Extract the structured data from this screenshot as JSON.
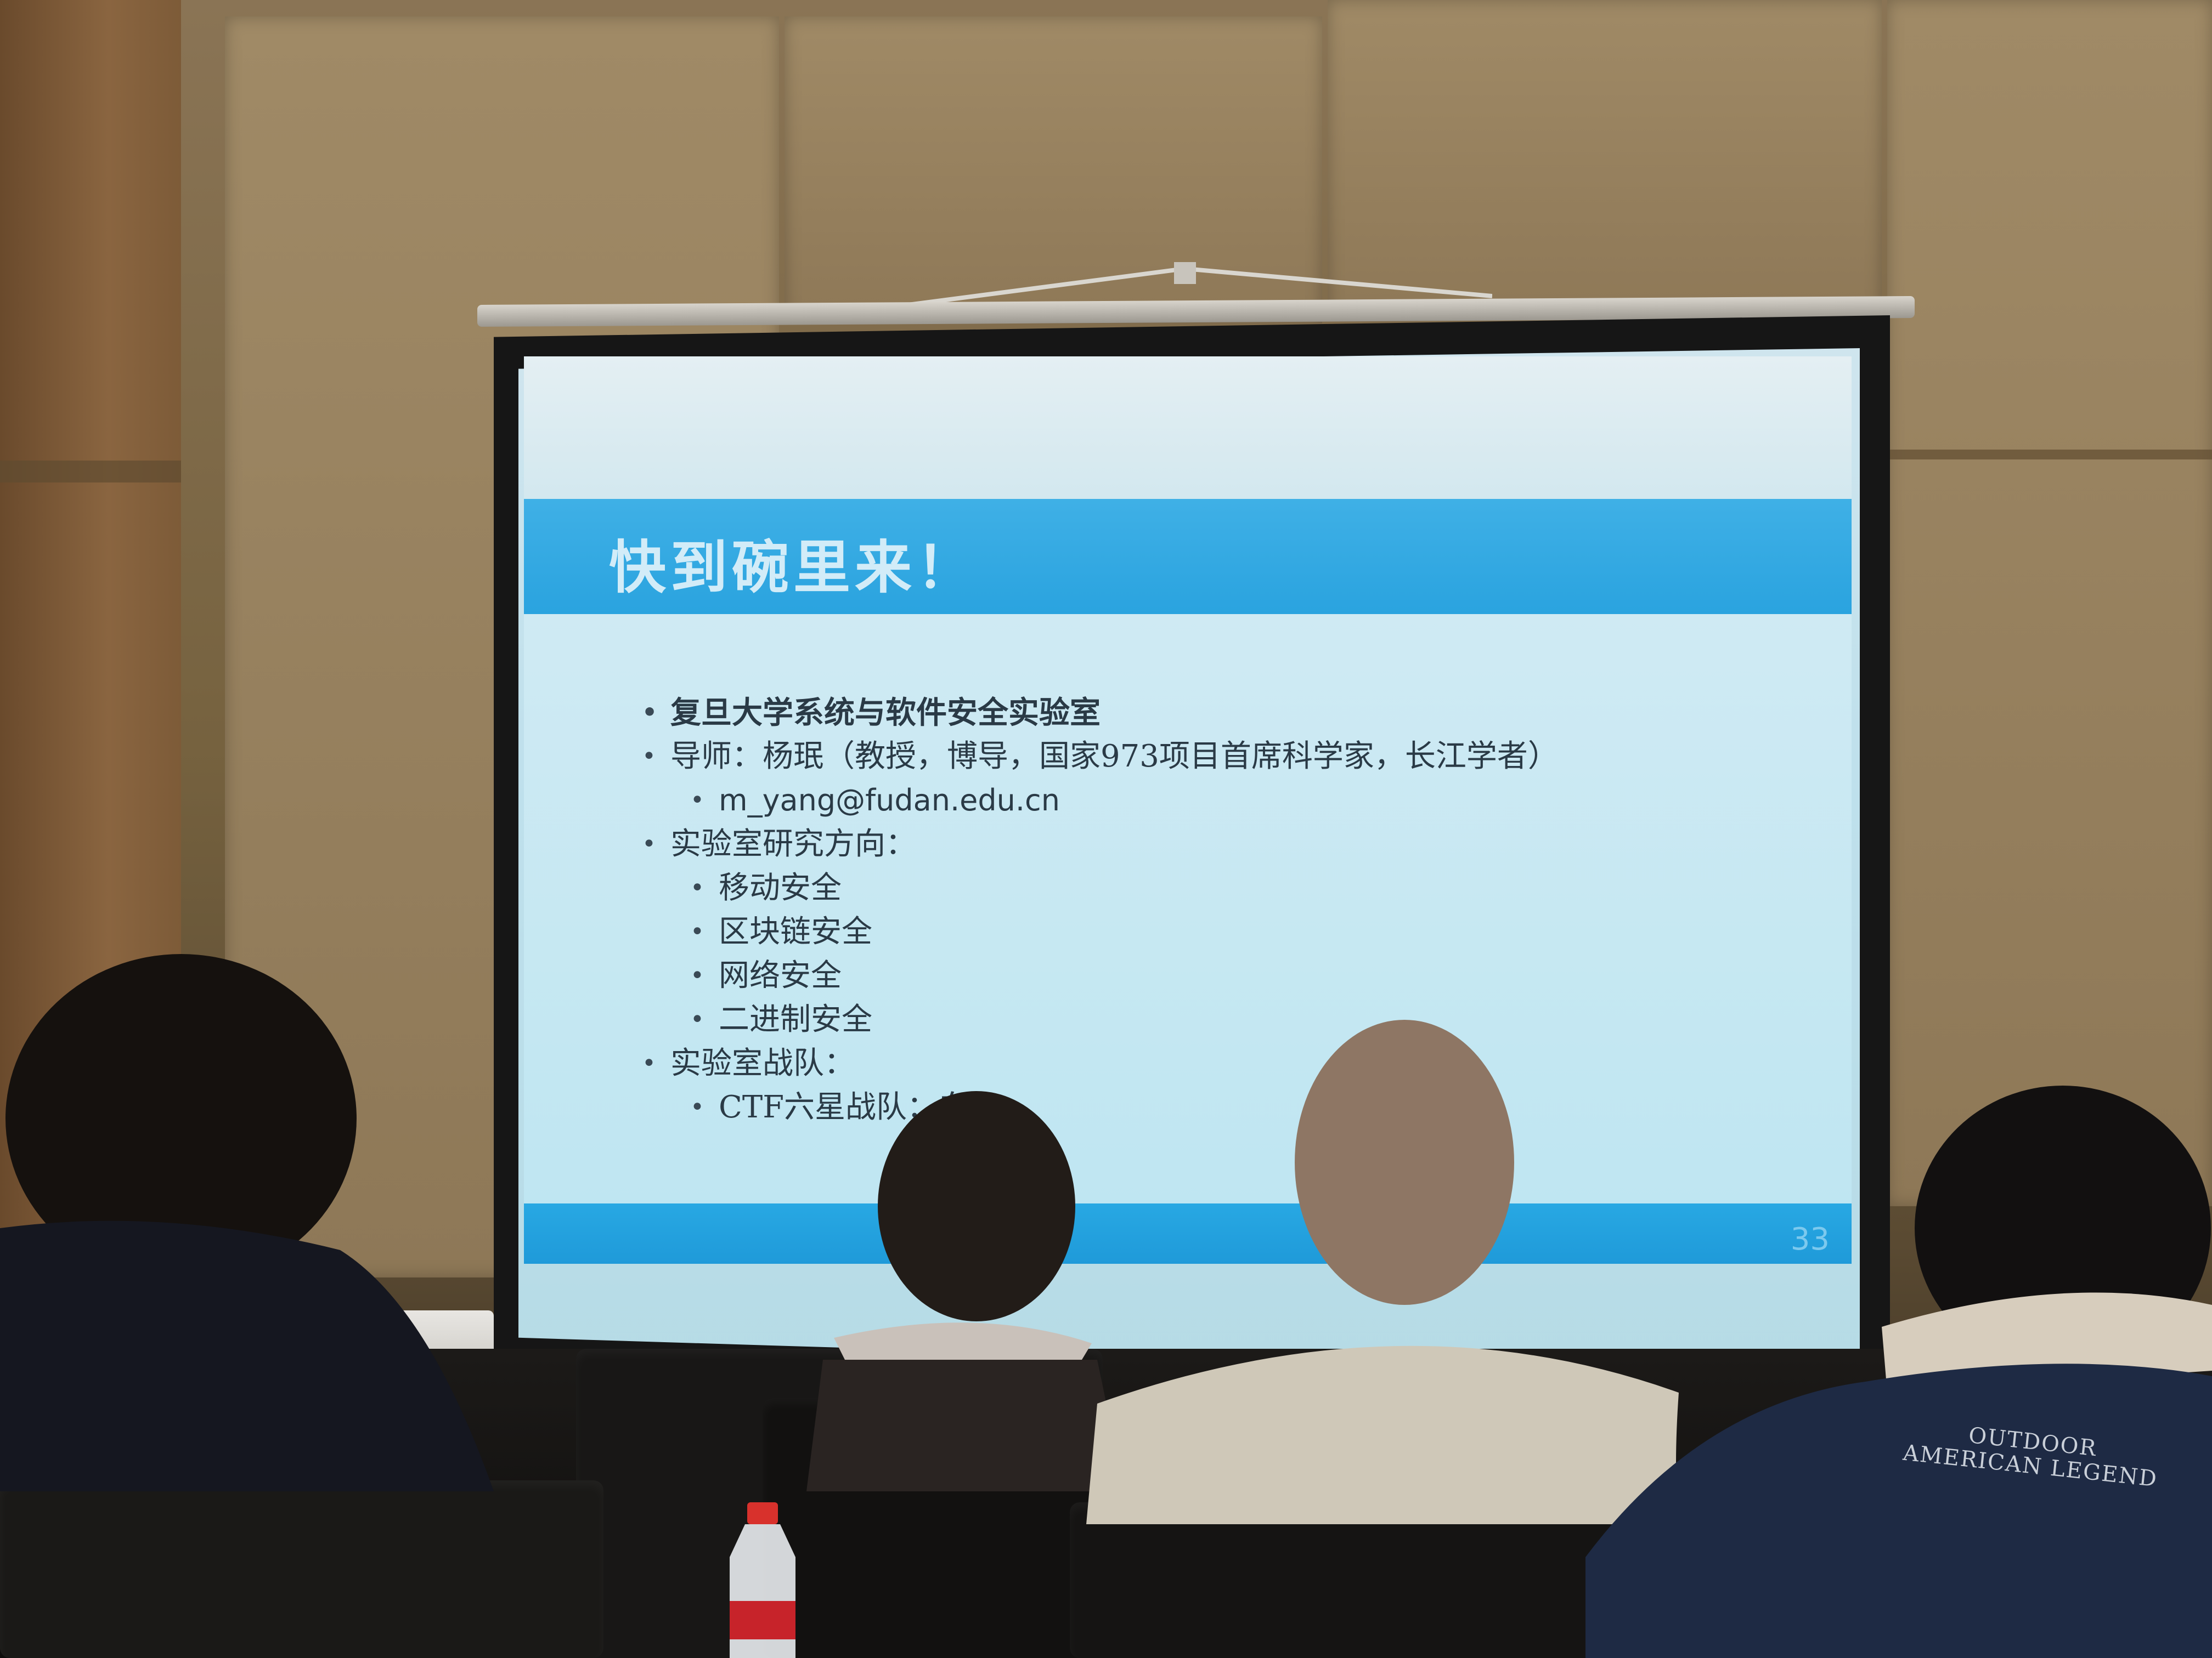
{
  "slide": {
    "title": "快到碗里来！",
    "page_number": "33",
    "bullets": [
      {
        "level": 1,
        "text": "复旦大学系统与软件安全实验室",
        "bold": true
      },
      {
        "level": 1,
        "text": "导师：杨珉（教授，博导，国家973项目首席科学家，长江学者）"
      },
      {
        "level": 2,
        "text": "m_yang@fudan.edu.cn",
        "mono": true
      },
      {
        "level": 1,
        "text": "实验室研究方向："
      },
      {
        "level": 2,
        "text": "移动安全"
      },
      {
        "level": 2,
        "text": "区块链安全"
      },
      {
        "level": 2,
        "text": "网络安全"
      },
      {
        "level": 2,
        "text": "二进制安全"
      },
      {
        "level": 1,
        "text": "实验室战队："
      },
      {
        "level": 2,
        "text": "CTF六星战队：白泽"
      }
    ]
  },
  "jacket": {
    "line1": "OUTDOOR",
    "line2": "AMERICAN LEGEND"
  },
  "colors": {
    "title_bar": "#2aa3df",
    "slide_body": "#c4e7f2",
    "footer_bar": "#1f9ad9"
  }
}
